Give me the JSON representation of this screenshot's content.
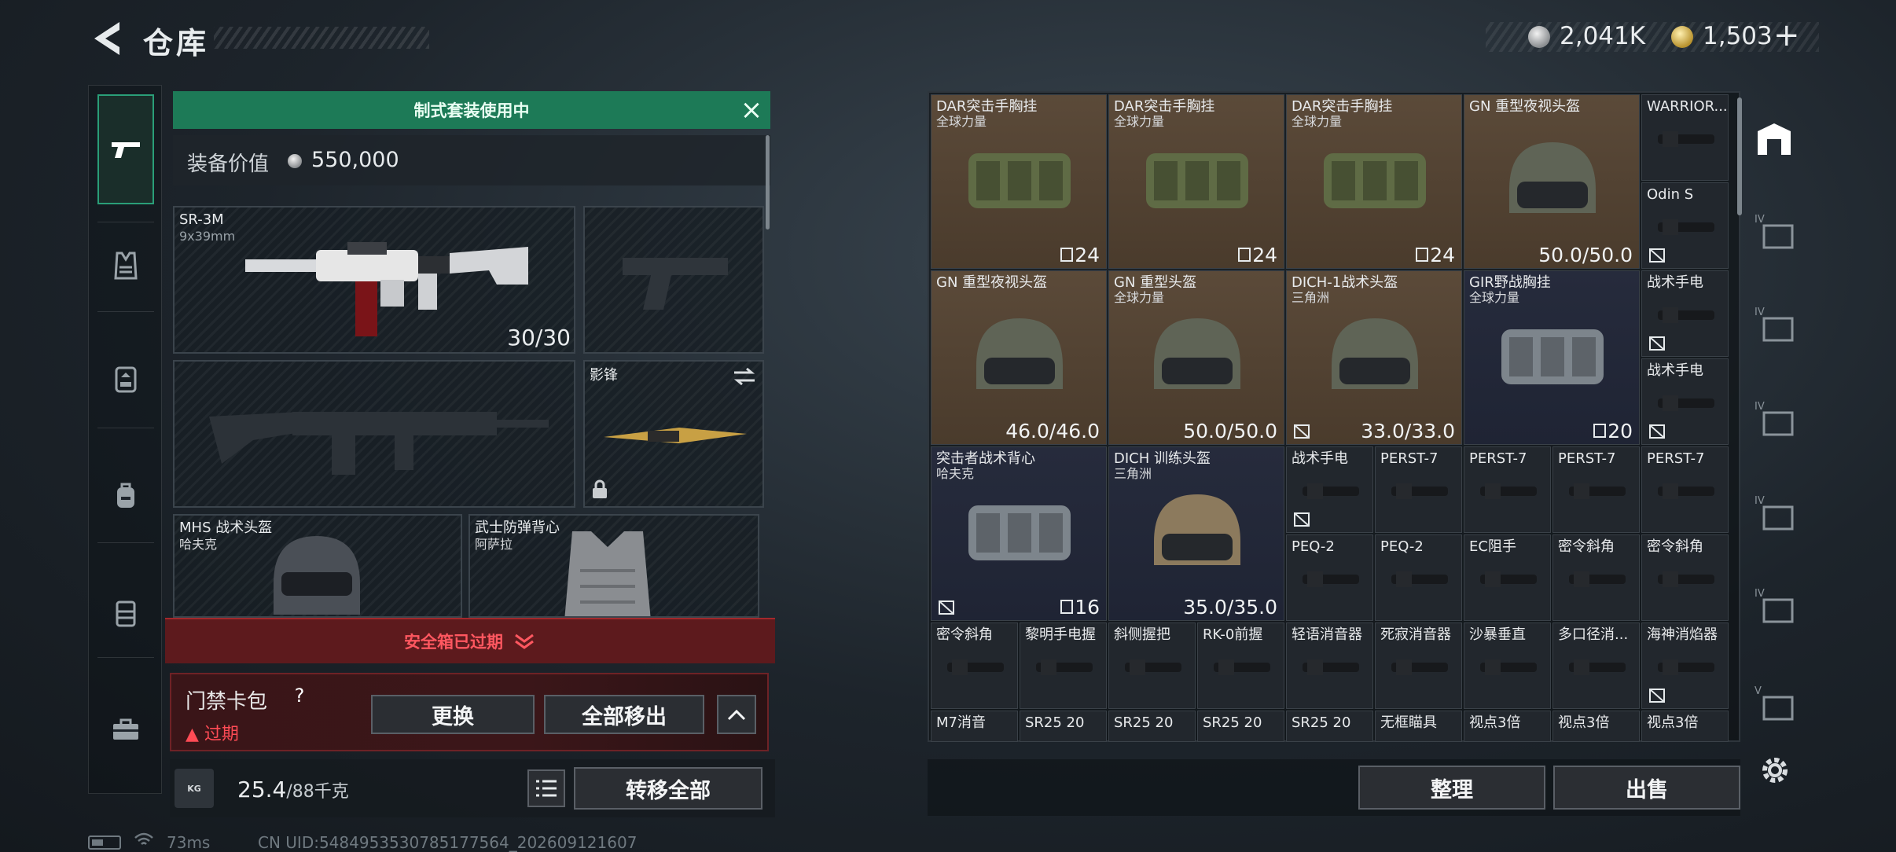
{
  "header": {
    "title": "仓库",
    "currency_silver": "2,041K",
    "currency_gold": "1,503",
    "plus_label": "+"
  },
  "left_nav": {
    "items": [
      "weapon-icon",
      "vest-icon",
      "armor-icon",
      "backpack-icon",
      "chest-rig-icon",
      "toolbox-icon"
    ],
    "active": "weapon-icon"
  },
  "loadout": {
    "banner": "制式套装使用中",
    "value_label": "装备价值",
    "value": "550,000",
    "primary_weapon": {
      "name": "SR-3M",
      "sub": "9x39mm",
      "count": "30/30"
    },
    "melee": {
      "name": "影锋"
    },
    "helmet": {
      "name": "MHS 战术头盔",
      "sub": "哈夫克"
    },
    "armor": {
      "name": "武士防弹背心",
      "sub": "阿萨拉"
    }
  },
  "safebox": {
    "label": "安全箱已过期",
    "keycard_label": "门禁卡包",
    "help": "?",
    "expired": "过期",
    "replace": "更换",
    "move_all": "全部移出",
    "collapse": "^"
  },
  "weight": {
    "icon_text": "KG",
    "current": "25.4",
    "max": "/88千克",
    "transfer_all": "转移全部"
  },
  "stash": {
    "items": [
      {
        "name": "DAR突击手胸挂",
        "sub": "全球力量",
        "count": "24",
        "color": "brown"
      },
      {
        "name": "DAR突击手胸挂",
        "sub": "全球力量",
        "count": "24",
        "color": "brown"
      },
      {
        "name": "DAR突击手胸挂",
        "sub": "全球力量",
        "count": "24",
        "color": "brown"
      },
      {
        "name": "GN 重型夜视头盔",
        "sub": "",
        "count": "50.0/50.0",
        "color": "brown"
      },
      {
        "name": "WARRIOR...",
        "sub": "",
        "count": "",
        "color": "gray"
      },
      {
        "name": "Odin S",
        "sub": "",
        "count": "",
        "color": "gray"
      },
      {
        "name": "GN 重型夜视头盔",
        "sub": "",
        "count": "46.0/46.0",
        "color": "brown"
      },
      {
        "name": "GN 重型头盔",
        "sub": "全球力量",
        "count": "50.0/50.0",
        "color": "brown"
      },
      {
        "name": "DICH-1战术头盔",
        "sub": "三角洲",
        "count": "33.0/33.0",
        "color": "brown"
      },
      {
        "name": "GIR野战胸挂",
        "sub": "全球力量",
        "count": "20",
        "color": "blue"
      },
      {
        "name": "战术手电",
        "sub": "",
        "count": "",
        "color": "gray"
      },
      {
        "name": "战术手电",
        "sub": "",
        "count": "",
        "color": "gray"
      },
      {
        "name": "突击者战术背心",
        "sub": "哈夫克",
        "count": "16",
        "color": "blue"
      },
      {
        "name": "DICH 训练头盔",
        "sub": "三角洲",
        "count": "35.0/35.0",
        "color": "blue"
      },
      {
        "name": "战术手电",
        "sub": "",
        "count": "",
        "color": "gray"
      },
      {
        "name": "PERST-7",
        "sub": "",
        "count": "",
        "color": "gray"
      },
      {
        "name": "PERST-7",
        "sub": "",
        "count": "",
        "color": "gray"
      },
      {
        "name": "PERST-7",
        "sub": "",
        "count": "",
        "color": "gray"
      },
      {
        "name": "PERST-7",
        "sub": "",
        "count": "",
        "color": "gray"
      },
      {
        "name": "PEQ-2",
        "sub": "",
        "count": "",
        "color": "gray"
      },
      {
        "name": "PEQ-2",
        "sub": "",
        "count": "",
        "color": "gray"
      },
      {
        "name": "EC阻手",
        "sub": "",
        "count": "",
        "color": "gray"
      },
      {
        "name": "密令斜角",
        "sub": "",
        "count": "",
        "color": "gray"
      },
      {
        "name": "密令斜角",
        "sub": "",
        "count": "",
        "color": "gray"
      },
      {
        "name": "密令斜角",
        "sub": "",
        "count": "",
        "color": "gray"
      },
      {
        "name": "黎明手电握",
        "sub": "",
        "count": "",
        "color": "gray"
      },
      {
        "name": "斜侧握把",
        "sub": "",
        "count": "",
        "color": "gray"
      },
      {
        "name": "RK-0前握",
        "sub": "",
        "count": "",
        "color": "gray"
      },
      {
        "name": "轻语消音器",
        "sub": "",
        "count": "",
        "color": "gray"
      },
      {
        "name": "死寂消音器",
        "sub": "",
        "count": "",
        "color": "gray"
      },
      {
        "name": "沙暴垂直",
        "sub": "",
        "count": "",
        "color": "gray"
      },
      {
        "name": "多口径消...",
        "sub": "",
        "count": "",
        "color": "gray"
      },
      {
        "name": "海神消焰器",
        "sub": "",
        "count": "",
        "color": "gray"
      },
      {
        "name": "M7消音",
        "sub": "",
        "count": "",
        "color": "gray"
      },
      {
        "name": "SR25 20",
        "sub": "",
        "count": "",
        "color": "gray"
      },
      {
        "name": "SR25 20",
        "sub": "",
        "count": "",
        "color": "gray"
      },
      {
        "name": "SR25 20",
        "sub": "",
        "count": "",
        "color": "gray"
      },
      {
        "name": "SR25 20",
        "sub": "",
        "count": "",
        "color": "gray"
      },
      {
        "name": "无框瞄具",
        "sub": "",
        "count": "",
        "color": "gray"
      },
      {
        "name": "视点3倍",
        "sub": "",
        "count": "",
        "color": "gray"
      },
      {
        "name": "视点3倍",
        "sub": "",
        "count": "",
        "color": "gray"
      },
      {
        "name": "视点3倍",
        "sub": "",
        "count": "",
        "color": "gray"
      }
    ],
    "sort_button": "整理",
    "sell_button": "出售"
  },
  "right_nav": {
    "items": [
      "stash-icon",
      "tier-iv-stash-1-icon",
      "tier-iv-stash-2-icon",
      "tier-iv-stash-3-icon",
      "tier-iv-stash-4-icon",
      "tier-iv-stash-5-icon",
      "tier-v-stash-icon"
    ]
  },
  "status": {
    "ping": "73ms",
    "uid": "CN UID:5484953530785177564_202609121607"
  },
  "colors": {
    "banner_green": "#1d7a57",
    "expired_red": "#ff4b55",
    "item_brown": "#5b4a39",
    "item_blue": "#262b3c"
  }
}
